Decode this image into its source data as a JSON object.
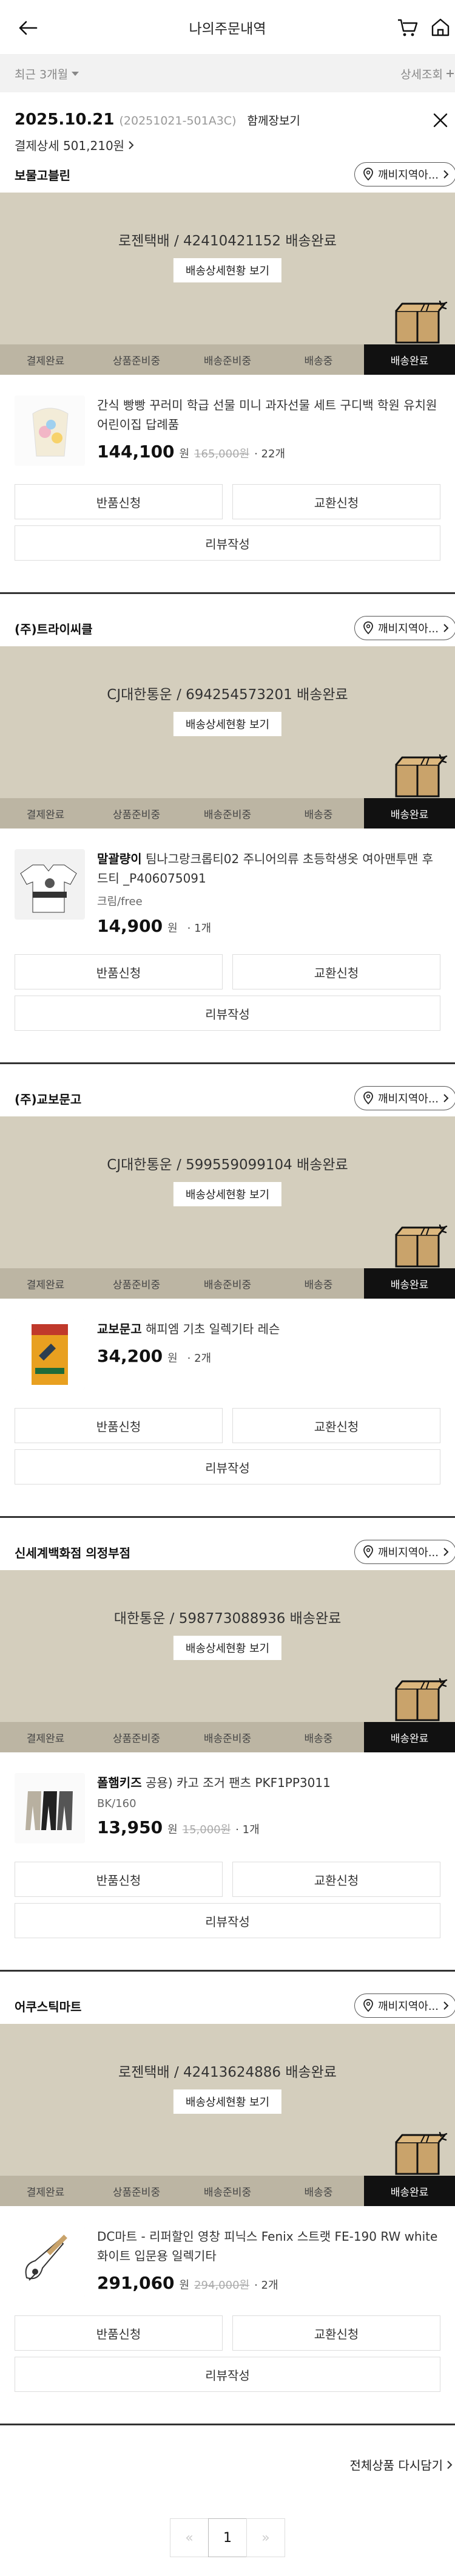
{
  "header": {
    "title": "나의주문내역"
  },
  "filter": {
    "period": "최근 3개월",
    "search": "상세조회"
  },
  "order": {
    "date": "2025.10.21",
    "order_no": "(20251021-501A3C)",
    "together_label": "함께장보기",
    "payment_label": "결제상세 501,210원"
  },
  "eco_label": "깨비지역아...",
  "track_button": "배송상세현황 보기",
  "steps": [
    "결제완료",
    "상품준비중",
    "배송준비중",
    "배송중",
    "배송완료"
  ],
  "buttons": {
    "return": "반품신청",
    "exchange": "교환신청",
    "review": "리뷰작성"
  },
  "sellers": [
    {
      "name": "보물고블린",
      "tracking": "로젠택배 / 42410421152 배송완료",
      "product": {
        "brand": "",
        "name": "간식 빵빵 꾸러미 학급 선물 미니 과자선물 세트 구디백 학원 유치원 어린이집 답례품",
        "option": "",
        "price": "144,100",
        "won": "원",
        "original": "165,000원",
        "qty": "22개"
      }
    },
    {
      "name": "(주)트라이씨클",
      "tracking": "CJ대한통운 / 694254573201 배송완료",
      "product": {
        "brand": "말괄량이",
        "name": " 팀나그랑크롭티02 주니어의류 초등학생옷 여아맨투맨 후드티 _P406075091",
        "option": "크림/free",
        "price": "14,900",
        "won": "원",
        "original": "",
        "qty": "1개"
      }
    },
    {
      "name": "(주)교보문고",
      "tracking": "CJ대한통운 / 599559099104 배송완료",
      "product": {
        "brand": "교보문고",
        "name": " 해피엠 기초 일렉기타 레슨",
        "option": "",
        "price": "34,200",
        "won": "원",
        "original": "",
        "qty": "2개"
      }
    },
    {
      "name": "신세계백화점 의정부점",
      "tracking": "대한통운 / 598773088936 배송완료",
      "product": {
        "brand": "폴햄키즈",
        "name": " 공용) 카고 조거 팬츠 PKF1PP3011",
        "option": "BK/160",
        "price": "13,950",
        "won": "원",
        "original": "15,000원",
        "qty": "1개"
      }
    },
    {
      "name": "어쿠스틱마트",
      "tracking": "로젠택배 / 42413624886 배송완료",
      "product": {
        "brand": "",
        "name": "DC마트 - 리퍼할인 영창 피닉스 Fenix 스트랫 FE-190 RW white 화이트 입문용 일렉기타",
        "option": "",
        "price": "291,060",
        "won": "원",
        "original": "294,000원",
        "qty": "2개"
      }
    }
  ],
  "reorder_label": "전체상품 다시담기",
  "pagination": {
    "current": "1",
    "prev": "«",
    "next": "»"
  },
  "colors": {
    "track_bg": "#d4cebd",
    "steps_bg": "#bcb5a3",
    "active_step": "#111111"
  }
}
